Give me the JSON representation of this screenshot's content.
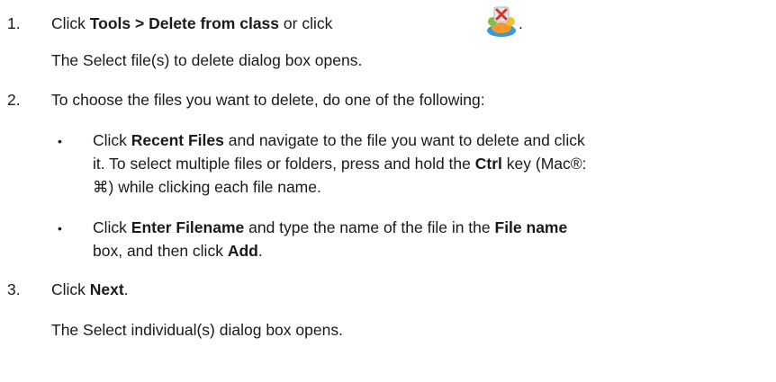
{
  "steps": [
    {
      "number": "1.",
      "parts": {
        "click": "Click ",
        "menu_path": "Tools > Delete from class",
        "or_click": " or click ",
        "period": "."
      },
      "result": "The Select file(s) to delete dialog box opens.",
      "icon": "delete-from-class-icon"
    },
    {
      "number": "2.",
      "text": "To choose the files you want to delete, do one of the following:",
      "bullets": [
        {
          "marker": "•",
          "l1_click": "Click ",
          "l1_bold": "Recent Files",
          "l1_rest": " and navigate to the file you want to delete and click",
          "l2": "it. To select multiple files or folders, press and hold the ",
          "l2_bold": "Ctrl",
          "l2_rest": " key (Mac®:",
          "l3": "⌘) while clicking each file name."
        },
        {
          "marker": "•",
          "l1_click": "Click ",
          "l1_bold": "Enter Filename",
          "l1_mid": " and type the name of the file in the ",
          "l1_bold2": "File name",
          "l2": "box, and then click ",
          "l2_bold": "Add",
          "l2_rest": "."
        }
      ]
    },
    {
      "number": "3.",
      "parts": {
        "click": "Click ",
        "bold": "Next",
        "period": "."
      },
      "result": "The Select individual(s) dialog box opens."
    }
  ]
}
